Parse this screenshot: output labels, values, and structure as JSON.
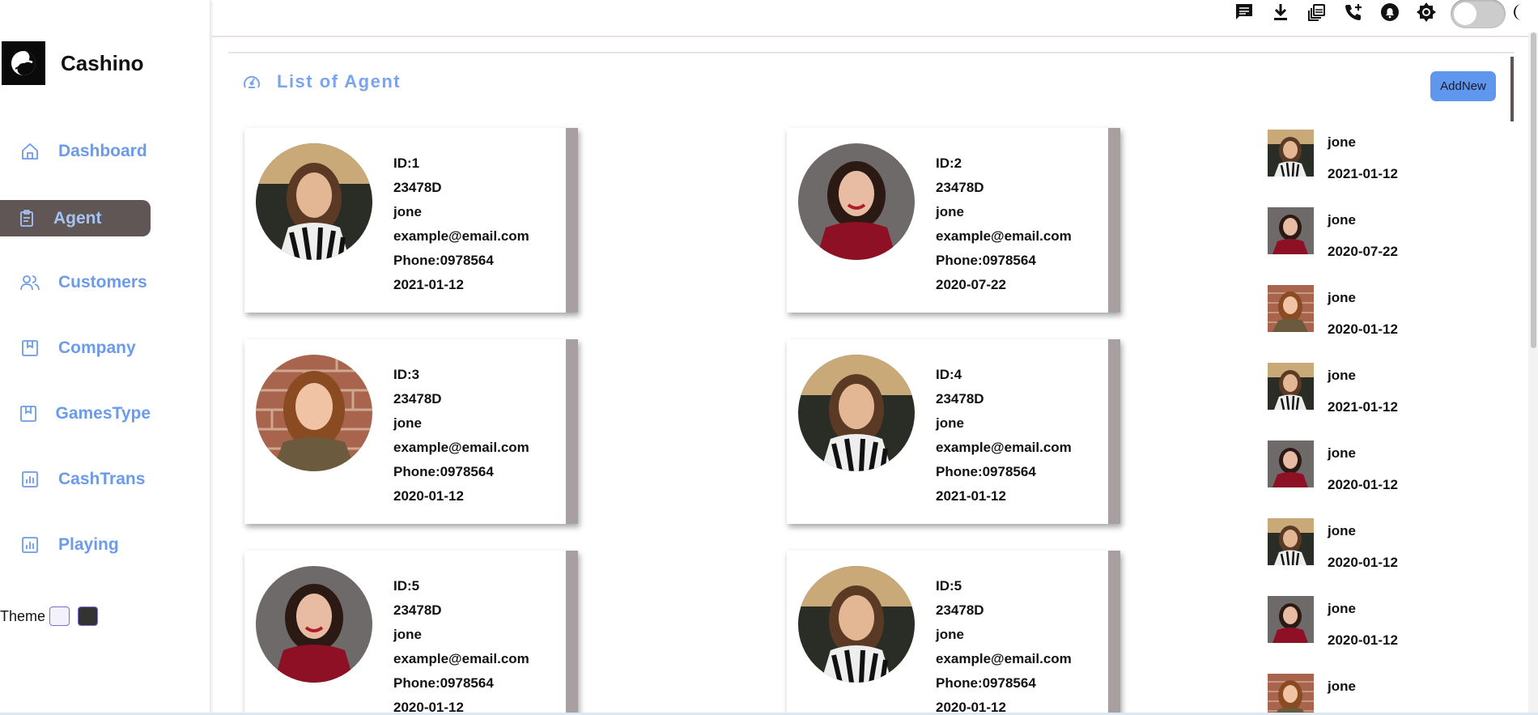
{
  "brand": {
    "name": "Cashino",
    "logo_icon": "swirl-logo"
  },
  "sidebar": {
    "items": [
      {
        "label": "Dashboard",
        "icon": "home-icon",
        "active": false
      },
      {
        "label": "Agent",
        "icon": "clipboard-icon",
        "active": true
      },
      {
        "label": "Customers",
        "icon": "users-icon",
        "active": false
      },
      {
        "label": "Company",
        "icon": "bookmark-icon",
        "active": false
      },
      {
        "label": "GamesType",
        "icon": "bookmark-icon",
        "active": false
      },
      {
        "label": "CashTrans",
        "icon": "bar-chart-icon",
        "active": false
      },
      {
        "label": "Playing",
        "icon": "bar-chart-icon",
        "active": false
      }
    ],
    "theme_label": "Theme"
  },
  "topbar": {
    "icons": [
      "message-icon",
      "download-icon",
      "copy-icon",
      "phone-add-icon",
      "notification-icon",
      "brightness-icon",
      "theme-toggle",
      "moon-icon"
    ]
  },
  "main": {
    "title": "List of Agent",
    "add_button": "AddNew"
  },
  "agents": [
    {
      "id": "ID:1",
      "code": "23478D",
      "name": "jone",
      "email": "example@email.com",
      "phone": "Phone:0978564",
      "date": "2021-01-12",
      "photo": "striped"
    },
    {
      "id": "ID:2",
      "code": "23478D",
      "name": "jone",
      "email": "example@email.com",
      "phone": "Phone:0978564",
      "date": "2020-07-22",
      "photo": "red"
    },
    {
      "id": "ID:3",
      "code": "23478D",
      "name": "jone",
      "email": "example@email.com",
      "phone": "Phone:0978564",
      "date": "2020-01-12",
      "photo": "brick"
    },
    {
      "id": "ID:4",
      "code": "23478D",
      "name": "jone",
      "email": "example@email.com",
      "phone": "Phone:0978564",
      "date": "2021-01-12",
      "photo": "striped"
    },
    {
      "id": "ID:5",
      "code": "23478D",
      "name": "jone",
      "email": "example@email.com",
      "phone": "Phone:0978564",
      "date": "2020-01-12",
      "photo": "red"
    },
    {
      "id": "ID:5",
      "code": "23478D",
      "name": "jone",
      "email": "example@email.com",
      "phone": "Phone:0978564",
      "date": "2020-01-12",
      "photo": "striped"
    }
  ],
  "recent": [
    {
      "name": "jone",
      "date": "2021-01-12",
      "photo": "striped"
    },
    {
      "name": "jone",
      "date": "2020-07-22",
      "photo": "red"
    },
    {
      "name": "jone",
      "date": "2020-01-12",
      "photo": "brick"
    },
    {
      "name": "jone",
      "date": "2021-01-12",
      "photo": "striped"
    },
    {
      "name": "jone",
      "date": "2020-01-12",
      "photo": "red"
    },
    {
      "name": "jone",
      "date": "2020-01-12",
      "photo": "striped"
    },
    {
      "name": "jone",
      "date": "2020-01-12",
      "photo": "red"
    },
    {
      "name": "jone",
      "date": "",
      "photo": "brick"
    }
  ],
  "colors": {
    "accent": "#6b9bea",
    "active_nav_bg": "#615656",
    "button": "#5f97ef",
    "card_edge": "#a8a0a0"
  }
}
